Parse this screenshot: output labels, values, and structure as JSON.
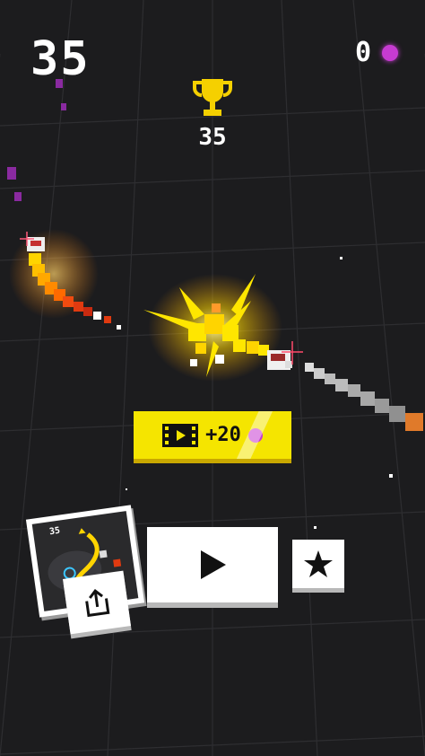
{
  "hud": {
    "score": "35",
    "gems": "0",
    "best_score": "35"
  },
  "ad_reward": {
    "amount": "+20"
  },
  "snapshot": {
    "score": "35"
  },
  "icons": {
    "trophy": "trophy-icon",
    "film": "film-icon",
    "gem": "gem-icon",
    "share": "share-icon",
    "play": "play-icon",
    "star": "star-icon"
  },
  "colors": {
    "background": "#1c1c1e",
    "accent_yellow": "#f5e500",
    "gem_purple": "#c63bd1"
  }
}
